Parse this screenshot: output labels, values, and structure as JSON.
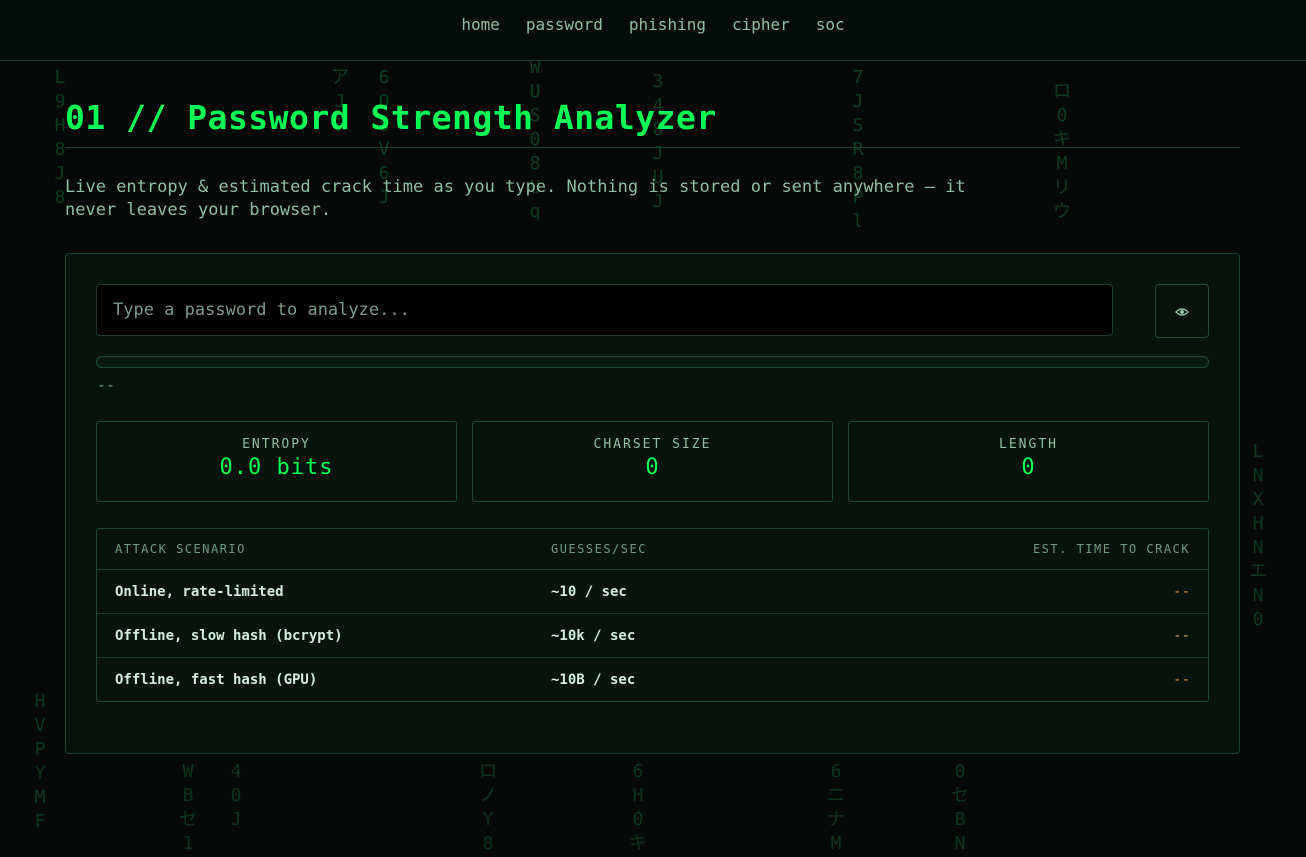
{
  "nav": {
    "links": [
      "home",
      "password",
      "phishing",
      "cipher",
      "soc"
    ]
  },
  "page": {
    "title": "01 // Password Strength Analyzer",
    "description": "Live entropy & estimated crack time as you type. Nothing is stored or sent anywhere — it never leaves your browser."
  },
  "analyzer": {
    "input": {
      "value": "",
      "placeholder": "Type a password to analyze..."
    },
    "toggle_icon": "eye-icon",
    "meter_fraction": 0,
    "strength_label": "--",
    "stats": [
      {
        "label": "ENTROPY",
        "value": "0.0 bits"
      },
      {
        "label": "CHARSET SIZE",
        "value": "0"
      },
      {
        "label": "LENGTH",
        "value": "0"
      }
    ]
  },
  "table": {
    "headers": [
      "ATTACK SCENARIO",
      "GUESSES/SEC",
      "EST. TIME TO CRACK"
    ],
    "rows": [
      {
        "scenario": "Online, rate-limited",
        "rate": "~10 / sec",
        "time": "--"
      },
      {
        "scenario": "Offline, slow hash (bcrypt)",
        "rate": "~10k / sec",
        "time": "--"
      },
      {
        "scenario": "Offline, fast hash (GPU)",
        "rate": "~10B / sec",
        "time": "--"
      }
    ]
  },
  "colors": {
    "accent": "#00ff55",
    "background": "#050a08",
    "warning": "#e0a030"
  }
}
